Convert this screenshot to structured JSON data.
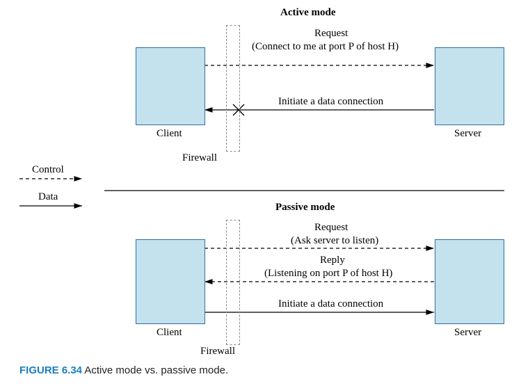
{
  "top_title": "Active mode",
  "top_request_line1": "Request",
  "top_request_line2": "(Connect to me at port P of host H)",
  "top_initiate": "Initiate a data connection",
  "top_client": "Client",
  "top_server": "Server",
  "top_firewall": "Firewall",
  "legend_control": "Control",
  "legend_data": "Data",
  "bottom_title": "Passive mode",
  "bottom_request_line1": "Request",
  "bottom_request_line2": "(Ask server to listen)",
  "bottom_reply_line1": "Reply",
  "bottom_reply_line2": "(Listening on port P of host H)",
  "bottom_initiate": "Initiate a data connection",
  "bottom_client": "Client",
  "bottom_server": "Server",
  "bottom_firewall": "Firewall",
  "caption_num": "FIGURE 6.34",
  "caption_text": " Active mode vs. passive mode."
}
